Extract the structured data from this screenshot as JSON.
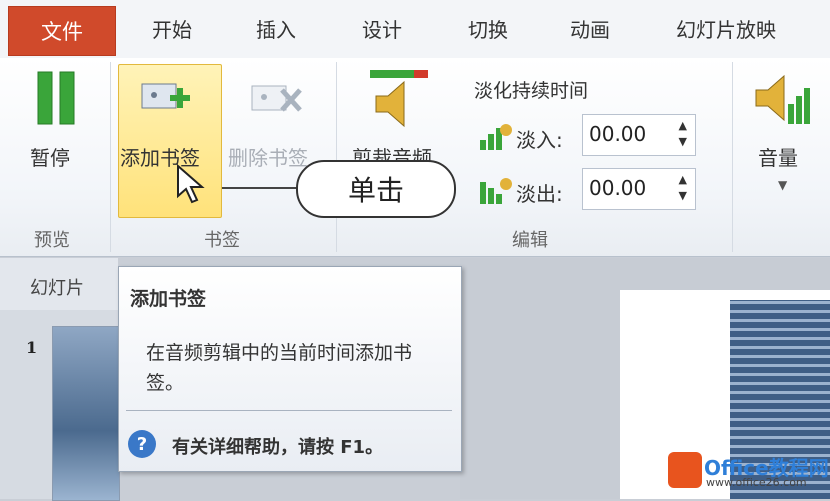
{
  "tabs": {
    "file": "文件",
    "items": [
      "开始",
      "插入",
      "设计",
      "切换",
      "动画",
      "幻灯片放映"
    ]
  },
  "ribbon": {
    "preview": {
      "pause_label": "暂停",
      "group_label": "预览"
    },
    "bookmarks": {
      "add_label": "添加书签",
      "remove_label": "删除书签",
      "group_label": "书签"
    },
    "editing": {
      "trim_label": "剪裁音频",
      "fade_title": "淡化持续时间",
      "fade_in_label": "淡入:",
      "fade_in_value": "00.00",
      "fade_out_label": "淡出:",
      "fade_out_value": "00.00",
      "group_label": "编辑"
    },
    "audio": {
      "volume_label": "音量"
    }
  },
  "callout": {
    "text": "单击"
  },
  "pane": {
    "slides_tab": "幻灯片",
    "slide_number": "1"
  },
  "tooltip": {
    "title": "添加书签",
    "description": "在音频剪辑中的当前时间添加书签。",
    "help": "有关详细帮助，请按 F1。"
  },
  "watermark": {
    "brand": "Office教程网",
    "url": "www.office26.com"
  },
  "colors": {
    "file_tab": "#d04a2b",
    "highlight": "#ffe27a",
    "help_icon": "#3a78c8"
  }
}
